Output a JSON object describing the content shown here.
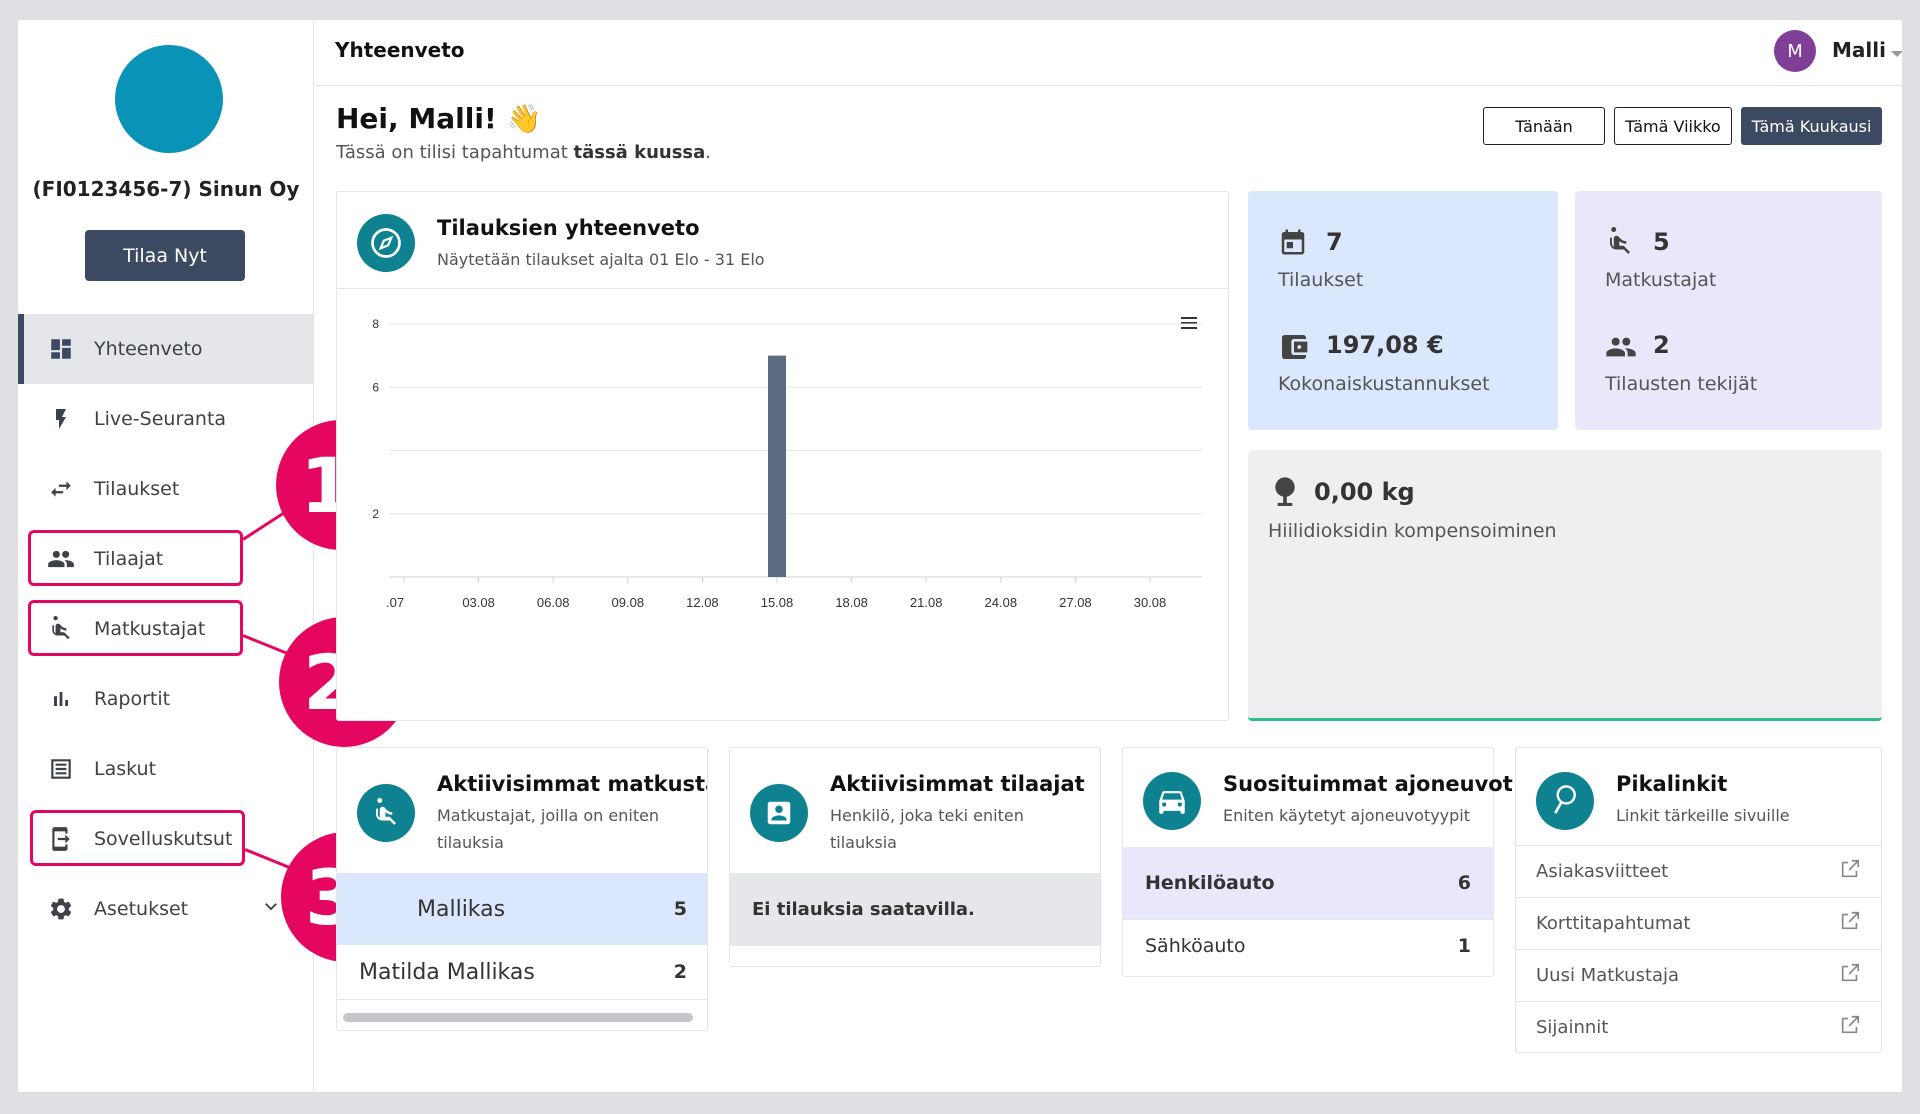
{
  "sidebar": {
    "company": "(FI0123456-7) Sinun Oy",
    "order_button": "Tilaa Nyt",
    "items": [
      {
        "label": "Yhteenveto",
        "icon": "dashboard-icon"
      },
      {
        "label": "Live-Seuranta",
        "icon": "bolt-icon"
      },
      {
        "label": "Tilaukset",
        "icon": "swap-arrows-icon"
      },
      {
        "label": "Tilaajat",
        "icon": "people-icon"
      },
      {
        "label": "Matkustajat",
        "icon": "wheelchair-icon"
      },
      {
        "label": "Raportit",
        "icon": "bar-chart-icon"
      },
      {
        "label": "Laskut",
        "icon": "invoice-list-icon"
      },
      {
        "label": "Sovelluskutsut",
        "icon": "app-invite-icon"
      },
      {
        "label": "Asetukset",
        "icon": "gear-icon"
      }
    ],
    "callouts": [
      "1.",
      "2.",
      "3."
    ]
  },
  "topbar": {
    "title": "Yhteenveto",
    "avatar_initial": "M",
    "user_name": "Malli"
  },
  "greeting": {
    "title": "Hei, Malli! 👋",
    "sub_prefix": "Tässä on tilisi tapahtumat ",
    "sub_bold": "tässä kuussa",
    "sub_suffix": "."
  },
  "range_buttons": {
    "today": "Tänään",
    "week": "Tämä Viikko",
    "month": "Tämä Kuukausi"
  },
  "orders_card": {
    "title": "Tilauksien yhteenveto",
    "subtitle": "Näytetään tilaukset ajalta 01 Elo - 31 Elo"
  },
  "chart_data": {
    "type": "bar",
    "x_ticks": [
      ".07",
      "03.08",
      "06.08",
      "09.08",
      "12.08",
      "15.08",
      "18.08",
      "21.08",
      "24.08",
      "27.08",
      "30.08"
    ],
    "y_ticks": [
      "2",
      "6",
      "8"
    ],
    "ylim": [
      0,
      8
    ],
    "bars": [
      {
        "x": "15.08",
        "value": 7
      }
    ],
    "grid": true,
    "bar_color": "#5b6b82"
  },
  "stats": {
    "orders_count": "7",
    "orders_label": "Tilaukset",
    "total_cost": "197,08 €",
    "total_cost_label": "Kokonaiskustannukset",
    "passengers_count": "5",
    "passengers_label": "Matkustajat",
    "orderers_count": "2",
    "orderers_label": "Tilausten tekijät",
    "co2_value": "0,00 kg",
    "co2_label": "Hiilidioksidin kompensoiminen"
  },
  "active_passengers": {
    "title": "Aktiivisimmat matkustaja",
    "subtitle_l1": "Matkustajat, joilla on eniten",
    "subtitle_l2": "tilauksia",
    "rows": [
      {
        "name": "Mallikas",
        "count": "5"
      },
      {
        "name": "Matilda Mallikas",
        "count": "2"
      }
    ]
  },
  "active_orderers": {
    "title": "Aktiivisimmat tilaajat",
    "subtitle_l1": "Henkilö, joka teki eniten",
    "subtitle_l2": "tilauksia",
    "empty": "Ei tilauksia saatavilla."
  },
  "vehicles": {
    "title": "Suosituimmat ajoneuvot",
    "subtitle": "Eniten käytetyt ajoneuvotyypit",
    "rows": [
      {
        "name": "Henkilöauto",
        "count": "6"
      },
      {
        "name": "Sähköauto",
        "count": "1"
      }
    ]
  },
  "quicklinks": {
    "title": "Pikalinkit",
    "subtitle": "Linkit tärkeille sivuille",
    "links": [
      "Asiakasviitteet",
      "Korttitapahtumat",
      "Uusi Matkustaja",
      "Sijainnit"
    ]
  }
}
